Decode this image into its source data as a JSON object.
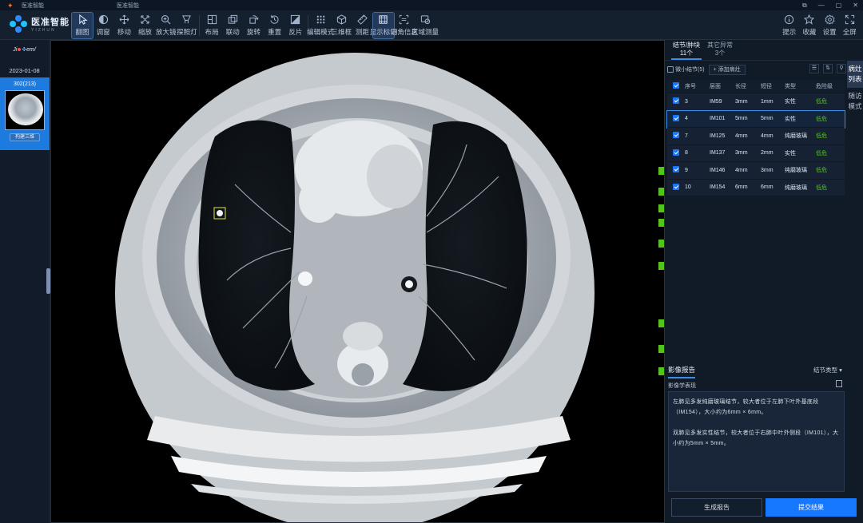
{
  "titlebar": {
    "app_name": "医准智能",
    "app_name_2": "医准智能",
    "win_buttons": [
      "⧉",
      "—",
      "▢",
      "✕"
    ]
  },
  "logo": {
    "name": "医准智能",
    "sub": "YIZHUN"
  },
  "toolbar": {
    "tools": [
      {
        "label": "翻图",
        "icon": "cursor-icon",
        "active": true
      },
      {
        "label": "调窗",
        "icon": "window-level-icon"
      },
      {
        "label": "移动",
        "icon": "move-icon"
      },
      {
        "label": "缩放",
        "icon": "zoom-icon"
      },
      {
        "label": "放大镜",
        "icon": "magnifier-icon"
      },
      {
        "label": "探照灯",
        "icon": "spotlight-icon"
      },
      {
        "label": "布局",
        "icon": "layout-icon"
      },
      {
        "label": "联动",
        "icon": "link-icon"
      },
      {
        "label": "旋转",
        "icon": "rotate-icon"
      },
      {
        "label": "重置",
        "icon": "reset-icon"
      },
      {
        "label": "反片",
        "icon": "invert-icon"
      },
      {
        "label": "编辑模式",
        "icon": "edit-mode-icon"
      },
      {
        "label": "三维框",
        "icon": "3d-box-icon"
      },
      {
        "label": "测距",
        "icon": "ruler-icon"
      },
      {
        "label": "显示标记",
        "icon": "show-marks-icon",
        "active": true
      },
      {
        "label": "四角信息",
        "icon": "corner-info-icon"
      },
      {
        "label": "区域测量",
        "icon": "region-measure-icon"
      }
    ],
    "right_tools": [
      {
        "label": "提示",
        "icon": "info-icon"
      },
      {
        "label": "收藏",
        "icon": "star-icon"
      },
      {
        "label": "设置",
        "icon": "gear-icon"
      },
      {
        "label": "全屏",
        "icon": "fullscreen-icon"
      }
    ]
  },
  "left_panel": {
    "logo_text_a": "Ji",
    "logo_text_b": "em/",
    "date": "2023-01-08",
    "series_count": "302(213)",
    "series_tag": "构建三维"
  },
  "right_panel": {
    "tabs": [
      {
        "label": "结节/肿块",
        "count": "11个",
        "active": true
      },
      {
        "label": "其它异常",
        "count": "3个",
        "active": false
      }
    ],
    "vertical_tabs": [
      "病灶列表",
      "随访模式"
    ],
    "filter_label": "微小结节(5)",
    "add_button": "+ 添加病灶",
    "table": {
      "headers": [
        "序号",
        "层面",
        "长径",
        "短径",
        "类型",
        "危险级"
      ],
      "rows": [
        {
          "no": "3",
          "slice": "IM59",
          "long": "3mm",
          "short": "1mm",
          "type": "实性",
          "risk": "低危"
        },
        {
          "no": "4",
          "slice": "IM101",
          "long": "5mm",
          "short": "5mm",
          "type": "实性",
          "risk": "低危",
          "selected": true
        },
        {
          "no": "7",
          "slice": "IM125",
          "long": "4mm",
          "short": "4mm",
          "type": "纯磨玻璃",
          "risk": "低危"
        },
        {
          "no": "8",
          "slice": "IM137",
          "long": "3mm",
          "short": "2mm",
          "type": "实性",
          "risk": "低危"
        },
        {
          "no": "9",
          "slice": "IM146",
          "long": "4mm",
          "short": "3mm",
          "type": "纯磨玻璃",
          "risk": "低危"
        },
        {
          "no": "10",
          "slice": "IM154",
          "long": "6mm",
          "short": "6mm",
          "type": "纯磨玻璃",
          "risk": "低危"
        }
      ]
    },
    "report": {
      "title": "影像报告",
      "dropdown": "结节类型",
      "subtitle": "影像学表现",
      "para1": "左肺见多发纯磨玻璃结节，较大者位于左肺下叶外基底段（IM154），大小约为6mm × 6mm。",
      "para2": "双肺见多发实性结节，较大者位于右肺中叶外侧段（IM101），大小约为5mm × 5mm。"
    },
    "buttons": {
      "generate": "生成报告",
      "submit": "提交结果"
    }
  },
  "colors": {
    "accent": "#1677ff",
    "risk_low": "#52c41a",
    "marker": "#52c41a",
    "bg": "#0b1422"
  }
}
